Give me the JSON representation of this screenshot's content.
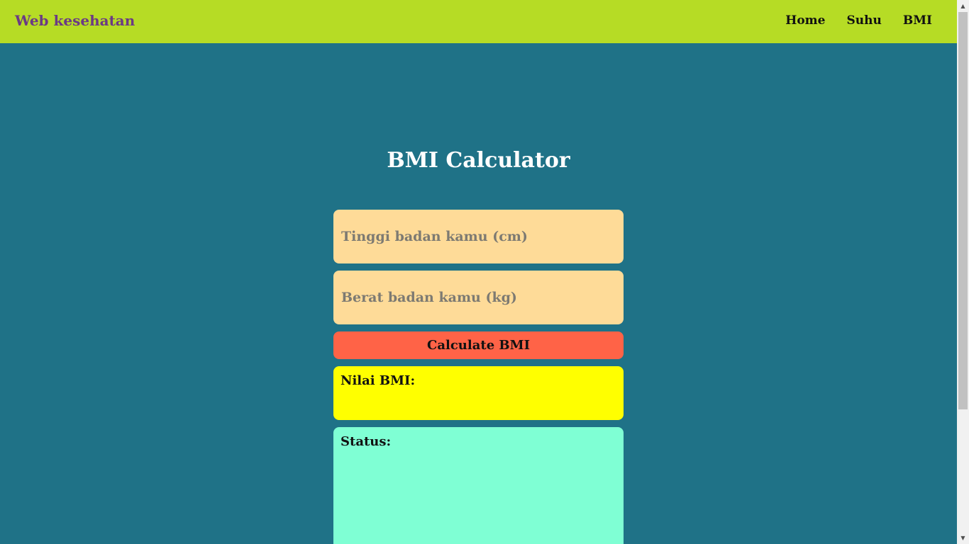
{
  "navbar": {
    "brand": "Web kesehatan",
    "links": [
      {
        "label": "Home"
      },
      {
        "label": "Suhu"
      },
      {
        "label": "BMI"
      }
    ]
  },
  "main": {
    "title": "BMI Calculator",
    "height_input": {
      "placeholder": "Tinggi badan kamu (cm)",
      "value": ""
    },
    "weight_input": {
      "placeholder": "Berat badan kamu (kg)",
      "value": ""
    },
    "calculate_label": "Calculate BMI",
    "result_label": "Nilai BMI:",
    "status_label": "Status:"
  },
  "colors": {
    "navbar_bg": "#b6dc25",
    "brand": "#6b3a84",
    "page_bg": "#1f7287",
    "input_bg": "#fedb98",
    "button_bg": "#ff6347",
    "result_bg": "#ffff00",
    "status_bg": "#7fffd4"
  },
  "icons": {
    "scroll_up": "scroll-up-arrow-icon",
    "scroll_down": "scroll-down-arrow-icon"
  }
}
